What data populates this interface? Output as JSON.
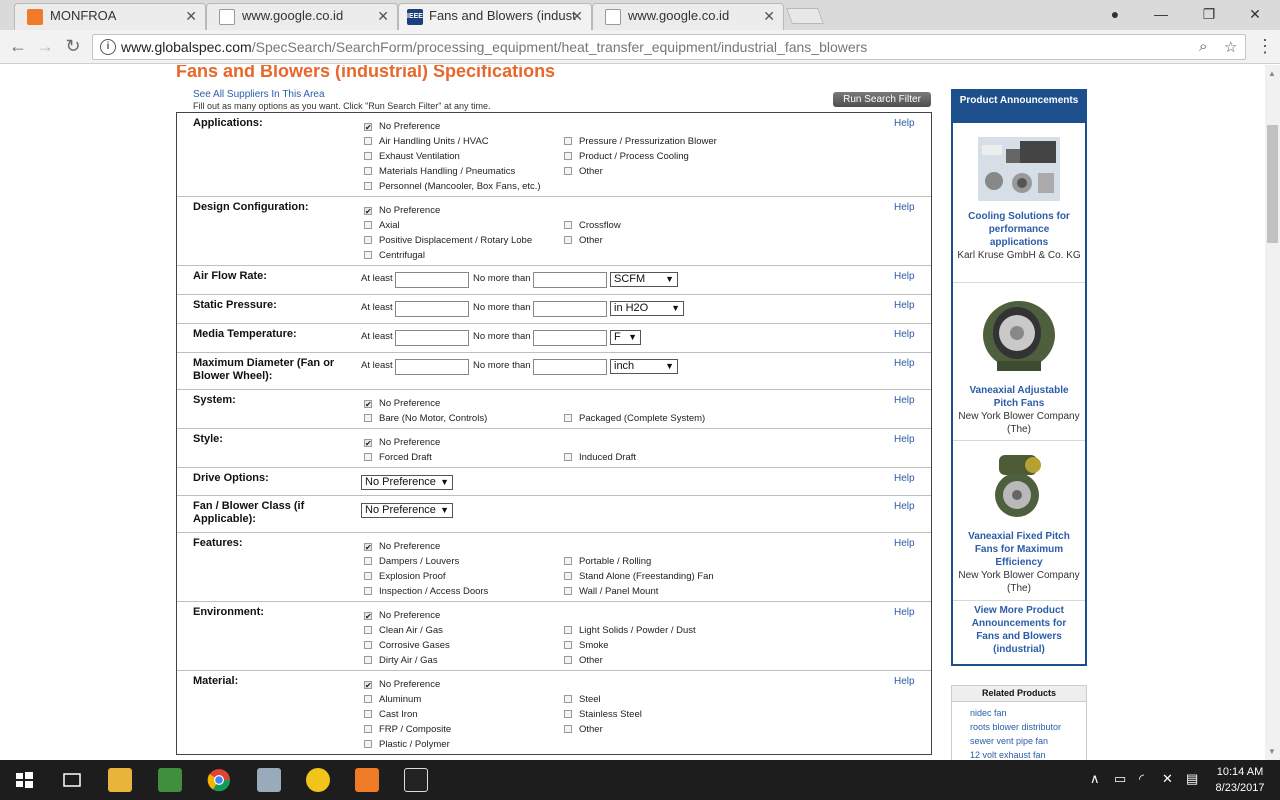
{
  "browser": {
    "tabs": [
      {
        "title": "MONFROA",
        "active": false
      },
      {
        "title": "www.google.co.id",
        "active": false
      },
      {
        "title": "Fans and Blowers (indust",
        "active": true
      },
      {
        "title": "www.google.co.id",
        "active": false
      }
    ],
    "url_host": "www.globalspec.com",
    "url_path": "/SpecSearch/SearchForm/processing_equipment/heat_transfer_equipment/industrial_fans_blowers"
  },
  "page": {
    "title": "Fans and Blowers (industrial) Specifications",
    "see_all": "See All Suppliers In This Area",
    "instructions": "Fill out as many options as you want. Click \"Run Search Filter\" at any time.",
    "run_button": "Run Search Filter",
    "help": "Help",
    "at_least": "At least",
    "no_more_than": "No more than",
    "applications": {
      "label": "Applications:",
      "no_pref": "No Preference",
      "col1": [
        "Air Handling Units / HVAC",
        "Exhaust Ventilation",
        "Materials Handling / Pneumatics",
        "Personnel (Mancooler, Box Fans, etc.)"
      ],
      "col2": [
        "Pressure / Pressurization Blower",
        "Product / Process Cooling",
        "Other"
      ]
    },
    "design": {
      "label": "Design Configuration:",
      "no_pref": "No Preference",
      "col1": [
        "Axial",
        "Positive Displacement / Rotary Lobe",
        "Centrifugal"
      ],
      "col2": [
        "Crossflow",
        "Other"
      ]
    },
    "air_flow": {
      "label": "Air Flow Rate:",
      "unit": "SCFM"
    },
    "static_pressure": {
      "label": "Static Pressure:",
      "unit": "in H2O"
    },
    "media_temp": {
      "label": "Media Temperature:",
      "unit": "F"
    },
    "max_diameter": {
      "label": "Maximum Diameter (Fan or Blower Wheel):",
      "unit": "inch"
    },
    "system": {
      "label": "System:",
      "no_pref": "No Preference",
      "col1": [
        "Bare (No Motor, Controls)"
      ],
      "col2": [
        "Packaged (Complete System)"
      ]
    },
    "style": {
      "label": "Style:",
      "no_pref": "No Preference",
      "col1": [
        "Forced Draft"
      ],
      "col2": [
        "Induced Draft"
      ]
    },
    "drive": {
      "label": "Drive Options:",
      "value": "No Preference"
    },
    "fan_class": {
      "label": "Fan / Blower Class (if Applicable):",
      "value": "No Preference"
    },
    "features": {
      "label": "Features:",
      "no_pref": "No Preference",
      "col1": [
        "Dampers / Louvers",
        "Explosion Proof",
        "Inspection / Access Doors"
      ],
      "col2": [
        "Portable / Rolling",
        "Stand Alone (Freestanding) Fan",
        "Wall / Panel Mount"
      ]
    },
    "environment": {
      "label": "Environment:",
      "no_pref": "No Preference",
      "col1": [
        "Clean Air / Gas",
        "Corrosive Gases",
        "Dirty Air / Gas"
      ],
      "col2": [
        "Light Solids / Powder / Dust",
        "Smoke",
        "Other"
      ]
    },
    "material": {
      "label": "Material:",
      "no_pref": "No Preference",
      "col1": [
        "Aluminum",
        "Cast Iron",
        "FRP / Composite",
        "Plastic / Polymer"
      ],
      "col2": [
        "Steel",
        "Stainless Steel",
        "Other"
      ]
    }
  },
  "sidebar": {
    "header": "Product Announcements",
    "items": [
      {
        "title": "Cooling Solutions for performance applications",
        "company": "Karl Kruse GmbH & Co. KG"
      },
      {
        "title": "Vaneaxial Adjustable Pitch Fans",
        "company": "New York Blower Company (The)"
      },
      {
        "title": "Vaneaxial Fixed Pitch Fans for Maximum Efficiency",
        "company": "New York Blower Company (The)"
      }
    ],
    "view_more": "View More Product Announcements for Fans and Blowers (industrial)",
    "related_header": "Related Products",
    "related": [
      "nidec fan",
      "roots blower distributor",
      "sewer vent pipe fan",
      "12 volt exhaust fan"
    ]
  },
  "taskbar": {
    "time": "10:14 AM",
    "date": "8/23/2017"
  }
}
